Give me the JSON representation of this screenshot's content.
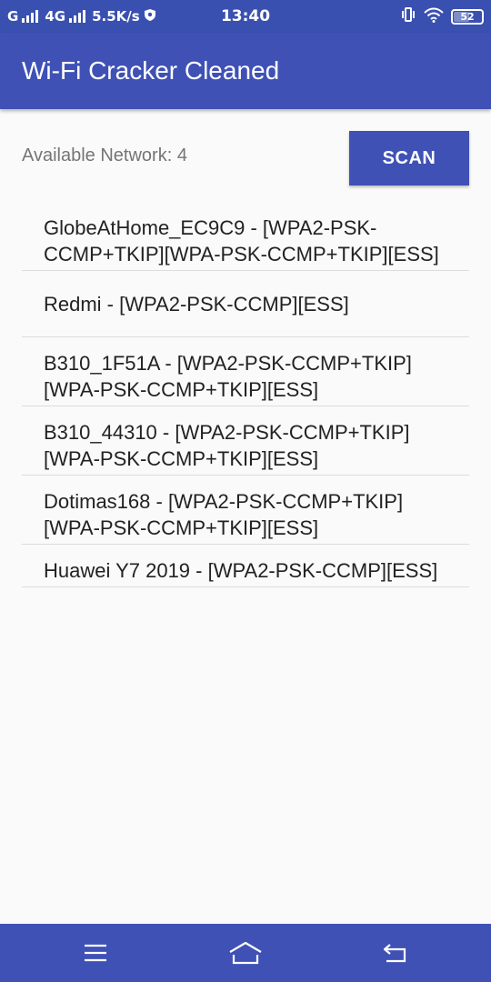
{
  "status_bar": {
    "carrier1": "G",
    "carrier2": "4G",
    "speed": "5.5K/s",
    "time": "13:40",
    "battery": "52"
  },
  "app_bar": {
    "title": "Wi-Fi Cracker Cleaned"
  },
  "main": {
    "available_label": "Available Network: 4",
    "scan_label": "SCAN",
    "networks": [
      {
        "text": "GlobeAtHome_EC9C9 - [WPA2-PSK-CCMP+TKIP][WPA-PSK-CCMP+TKIP][ESS]"
      },
      {
        "text": "Redmi - [WPA2-PSK-CCMP][ESS]"
      },
      {
        "text": "B310_1F51A - [WPA2-PSK-CCMP+TKIP][WPA-PSK-CCMP+TKIP][ESS]"
      },
      {
        "text": "B310_44310 - [WPA2-PSK-CCMP+TKIP][WPA-PSK-CCMP+TKIP][ESS]"
      },
      {
        "text": "Dotimas168 - [WPA2-PSK-CCMP+TKIP][WPA-PSK-CCMP+TKIP][ESS]"
      },
      {
        "text": "Huawei Y7 2019 - [WPA2-PSK-CCMP][ESS]"
      }
    ]
  },
  "colors": {
    "primary": "#3f51b5",
    "status_bar": "#3a50b0",
    "background": "#fafafa"
  },
  "icons": {
    "signal": "signal-bars-icon",
    "vpn": "shield-icon",
    "vibrate": "vibrate-icon",
    "wifi": "wifi-icon",
    "menu": "menu-icon",
    "home": "home-icon",
    "back": "back-icon"
  }
}
